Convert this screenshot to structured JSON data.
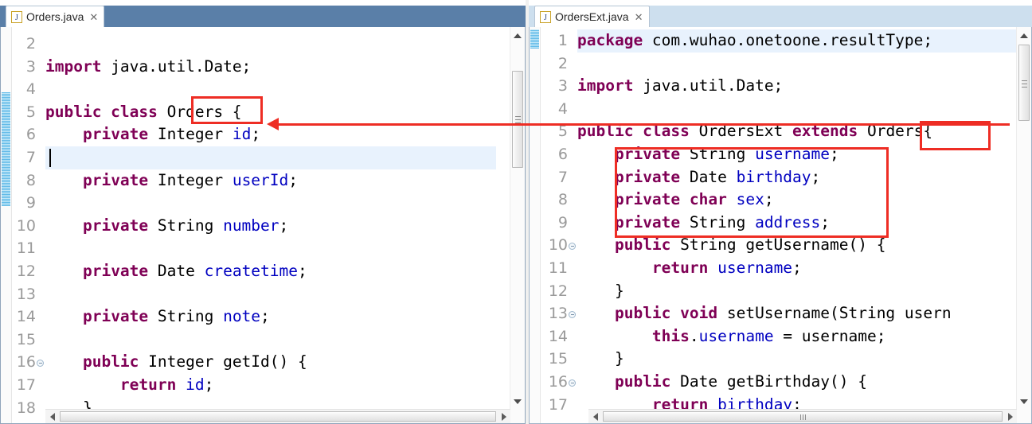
{
  "app": {
    "kind": "java-ide-editor-split-view",
    "accent_active_tabstrip": "#5a7fa8",
    "accent_inactive_tabstrip": "#cddfee",
    "annotation_color": "#ee2d24",
    "keyword_color": "#7f0055",
    "field_color": "#0000c0",
    "current_line_color": "#e8f2fd"
  },
  "left_editor": {
    "tab": {
      "label": "Orders.java",
      "icon": "java-file-icon",
      "close_icon": "close-icon",
      "active": true
    },
    "current_line": 7,
    "first_visible_line": 2,
    "lines": [
      {
        "num": "2",
        "fold": false,
        "tokens": []
      },
      {
        "num": "3",
        "fold": false,
        "tokens": [
          {
            "t": "import",
            "c": "kw"
          },
          {
            "t": " java.util.Date;",
            "c": "pln"
          }
        ]
      },
      {
        "num": "4",
        "fold": false,
        "tokens": []
      },
      {
        "num": "5",
        "fold": false,
        "tokens": [
          {
            "t": "public class",
            "c": "kw"
          },
          {
            "t": " Orders {",
            "c": "pln"
          }
        ]
      },
      {
        "num": "6",
        "fold": false,
        "tokens": [
          {
            "t": "    ",
            "c": "pln"
          },
          {
            "t": "private",
            "c": "kw"
          },
          {
            "t": " Integer ",
            "c": "pln"
          },
          {
            "t": "id",
            "c": "fld"
          },
          {
            "t": ";",
            "c": "pln"
          }
        ]
      },
      {
        "num": "7",
        "fold": false,
        "tokens": []
      },
      {
        "num": "8",
        "fold": false,
        "tokens": [
          {
            "t": "    ",
            "c": "pln"
          },
          {
            "t": "private",
            "c": "kw"
          },
          {
            "t": " Integer ",
            "c": "pln"
          },
          {
            "t": "userId",
            "c": "fld"
          },
          {
            "t": ";",
            "c": "pln"
          }
        ]
      },
      {
        "num": "9",
        "fold": false,
        "tokens": []
      },
      {
        "num": "10",
        "fold": false,
        "tokens": [
          {
            "t": "    ",
            "c": "pln"
          },
          {
            "t": "private",
            "c": "kw"
          },
          {
            "t": " String ",
            "c": "pln"
          },
          {
            "t": "number",
            "c": "fld"
          },
          {
            "t": ";",
            "c": "pln"
          }
        ]
      },
      {
        "num": "11",
        "fold": false,
        "tokens": []
      },
      {
        "num": "12",
        "fold": false,
        "tokens": [
          {
            "t": "    ",
            "c": "pln"
          },
          {
            "t": "private",
            "c": "kw"
          },
          {
            "t": " Date ",
            "c": "pln"
          },
          {
            "t": "createtime",
            "c": "fld"
          },
          {
            "t": ";",
            "c": "pln"
          }
        ]
      },
      {
        "num": "13",
        "fold": false,
        "tokens": []
      },
      {
        "num": "14",
        "fold": false,
        "tokens": [
          {
            "t": "    ",
            "c": "pln"
          },
          {
            "t": "private",
            "c": "kw"
          },
          {
            "t": " String ",
            "c": "pln"
          },
          {
            "t": "note",
            "c": "fld"
          },
          {
            "t": ";",
            "c": "pln"
          }
        ]
      },
      {
        "num": "15",
        "fold": false,
        "tokens": []
      },
      {
        "num": "16",
        "fold": true,
        "tokens": [
          {
            "t": "    ",
            "c": "pln"
          },
          {
            "t": "public",
            "c": "kw"
          },
          {
            "t": " Integer getId() {",
            "c": "pln"
          }
        ]
      },
      {
        "num": "17",
        "fold": false,
        "tokens": [
          {
            "t": "        ",
            "c": "pln"
          },
          {
            "t": "return",
            "c": "kw"
          },
          {
            "t": " ",
            "c": "pln"
          },
          {
            "t": "id",
            "c": "fld"
          },
          {
            "t": ";",
            "c": "pln"
          }
        ]
      },
      {
        "num": "18",
        "fold": false,
        "tokens": [
          {
            "t": "    }",
            "c": "pln"
          }
        ]
      }
    ]
  },
  "right_editor": {
    "tab": {
      "label": "OrdersExt.java",
      "icon": "java-file-icon",
      "close_icon": "close-icon",
      "active": false
    },
    "current_line": 1,
    "first_visible_line": 1,
    "lines": [
      {
        "num": "1",
        "fold": false,
        "tokens": [
          {
            "t": "package",
            "c": "kw"
          },
          {
            "t": " com.wuhao.onetoone.resultType;",
            "c": "pln"
          }
        ]
      },
      {
        "num": "2",
        "fold": false,
        "tokens": []
      },
      {
        "num": "3",
        "fold": false,
        "tokens": [
          {
            "t": "import",
            "c": "kw"
          },
          {
            "t": " java.util.Date;",
            "c": "pln"
          }
        ]
      },
      {
        "num": "4",
        "fold": false,
        "tokens": []
      },
      {
        "num": "5",
        "fold": false,
        "tokens": [
          {
            "t": "public class",
            "c": "kw"
          },
          {
            "t": " OrdersExt ",
            "c": "pln"
          },
          {
            "t": "extends",
            "c": "kw"
          },
          {
            "t": " Orders{",
            "c": "pln"
          }
        ]
      },
      {
        "num": "6",
        "fold": false,
        "tokens": [
          {
            "t": "    ",
            "c": "pln"
          },
          {
            "t": "private",
            "c": "kw"
          },
          {
            "t": " String ",
            "c": "pln"
          },
          {
            "t": "username",
            "c": "fld"
          },
          {
            "t": ";",
            "c": "pln"
          }
        ]
      },
      {
        "num": "7",
        "fold": false,
        "tokens": [
          {
            "t": "    ",
            "c": "pln"
          },
          {
            "t": "private",
            "c": "kw"
          },
          {
            "t": " Date ",
            "c": "pln"
          },
          {
            "t": "birthday",
            "c": "fld"
          },
          {
            "t": ";",
            "c": "pln"
          }
        ]
      },
      {
        "num": "8",
        "fold": false,
        "tokens": [
          {
            "t": "    ",
            "c": "pln"
          },
          {
            "t": "private",
            "c": "kw"
          },
          {
            "t": " ",
            "c": "pln"
          },
          {
            "t": "char",
            "c": "kw"
          },
          {
            "t": " ",
            "c": "pln"
          },
          {
            "t": "sex",
            "c": "fld"
          },
          {
            "t": ";",
            "c": "pln"
          }
        ]
      },
      {
        "num": "9",
        "fold": false,
        "tokens": [
          {
            "t": "    ",
            "c": "pln"
          },
          {
            "t": "private",
            "c": "kw"
          },
          {
            "t": " String ",
            "c": "pln"
          },
          {
            "t": "address",
            "c": "fld"
          },
          {
            "t": ";",
            "c": "pln"
          }
        ]
      },
      {
        "num": "10",
        "fold": true,
        "tokens": [
          {
            "t": "    ",
            "c": "pln"
          },
          {
            "t": "public",
            "c": "kw"
          },
          {
            "t": " String getUsername() {",
            "c": "pln"
          }
        ]
      },
      {
        "num": "11",
        "fold": false,
        "tokens": [
          {
            "t": "        ",
            "c": "pln"
          },
          {
            "t": "return",
            "c": "kw"
          },
          {
            "t": " ",
            "c": "pln"
          },
          {
            "t": "username",
            "c": "fld"
          },
          {
            "t": ";",
            "c": "pln"
          }
        ]
      },
      {
        "num": "12",
        "fold": false,
        "tokens": [
          {
            "t": "    }",
            "c": "pln"
          }
        ]
      },
      {
        "num": "13",
        "fold": true,
        "tokens": [
          {
            "t": "    ",
            "c": "pln"
          },
          {
            "t": "public void",
            "c": "kw"
          },
          {
            "t": " setUsername(String usern",
            "c": "pln"
          }
        ]
      },
      {
        "num": "14",
        "fold": false,
        "tokens": [
          {
            "t": "        ",
            "c": "pln"
          },
          {
            "t": "this",
            "c": "kw"
          },
          {
            "t": ".",
            "c": "pln"
          },
          {
            "t": "username",
            "c": "fld"
          },
          {
            "t": " = username;",
            "c": "pln"
          }
        ]
      },
      {
        "num": "15",
        "fold": false,
        "tokens": [
          {
            "t": "    }",
            "c": "pln"
          }
        ]
      },
      {
        "num": "16",
        "fold": true,
        "tokens": [
          {
            "t": "    ",
            "c": "pln"
          },
          {
            "t": "public",
            "c": "kw"
          },
          {
            "t": " Date getBirthday() {",
            "c": "pln"
          }
        ]
      },
      {
        "num": "17",
        "fold": false,
        "tokens": [
          {
            "t": "        ",
            "c": "pln"
          },
          {
            "t": "return",
            "c": "kw"
          },
          {
            "t": " ",
            "c": "pln"
          },
          {
            "t": "birthday",
            "c": "fld"
          },
          {
            "t": ";",
            "c": "pln"
          }
        ]
      }
    ]
  },
  "annotations": {
    "box_left_orders": {
      "target": "Orders",
      "editor": "left",
      "line": 5
    },
    "box_right_orders": {
      "target": "Orders",
      "editor": "right",
      "line": 5
    },
    "box_right_fields": {
      "target": "private field block",
      "editor": "right",
      "lines": "6-9"
    },
    "arrow": {
      "from": "right-editor Orders superclass",
      "to": "left-editor Orders class declaration",
      "direction": "right-to-left"
    }
  }
}
